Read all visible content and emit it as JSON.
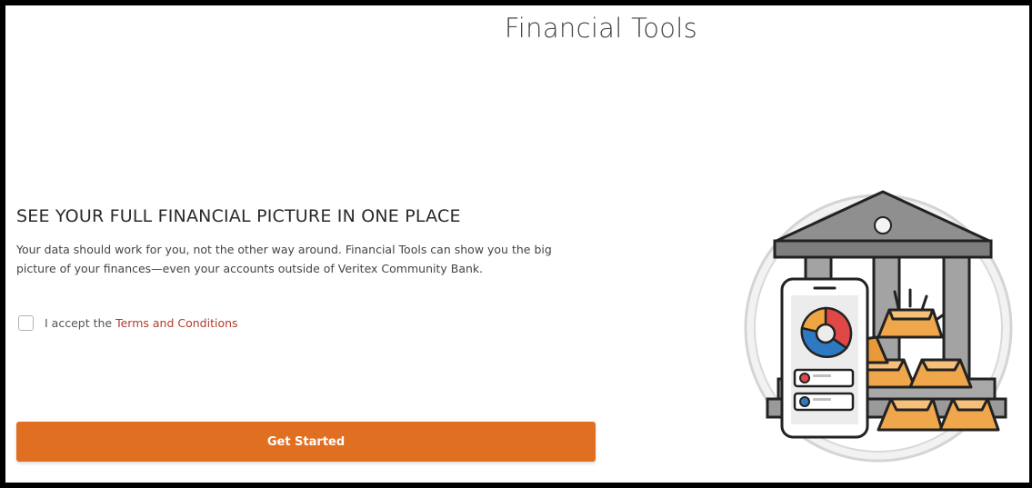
{
  "header": {
    "title": "Financial Tools"
  },
  "intro": {
    "headline": "SEE YOUR FULL FINANCIAL PICTURE IN ONE PLACE",
    "line1": "Your data should work for you, not the other way around. Financial Tools can show you the big",
    "line2": "picture of your finances—even your accounts outside of Veritex Community Bank."
  },
  "terms": {
    "prefix": "I accept the",
    "link": "Terms and Conditions",
    "checked": false
  },
  "actions": {
    "get_started": "Get Started"
  },
  "illustration": {
    "icon": "bank-phone-gold-illustration"
  },
  "colors": {
    "accent": "#e06f22",
    "link": "#b23a2a",
    "gold": "#f0a64a",
    "pie_red": "#e04848",
    "pie_blue": "#2d7ac2",
    "pie_orange": "#f0a640"
  }
}
